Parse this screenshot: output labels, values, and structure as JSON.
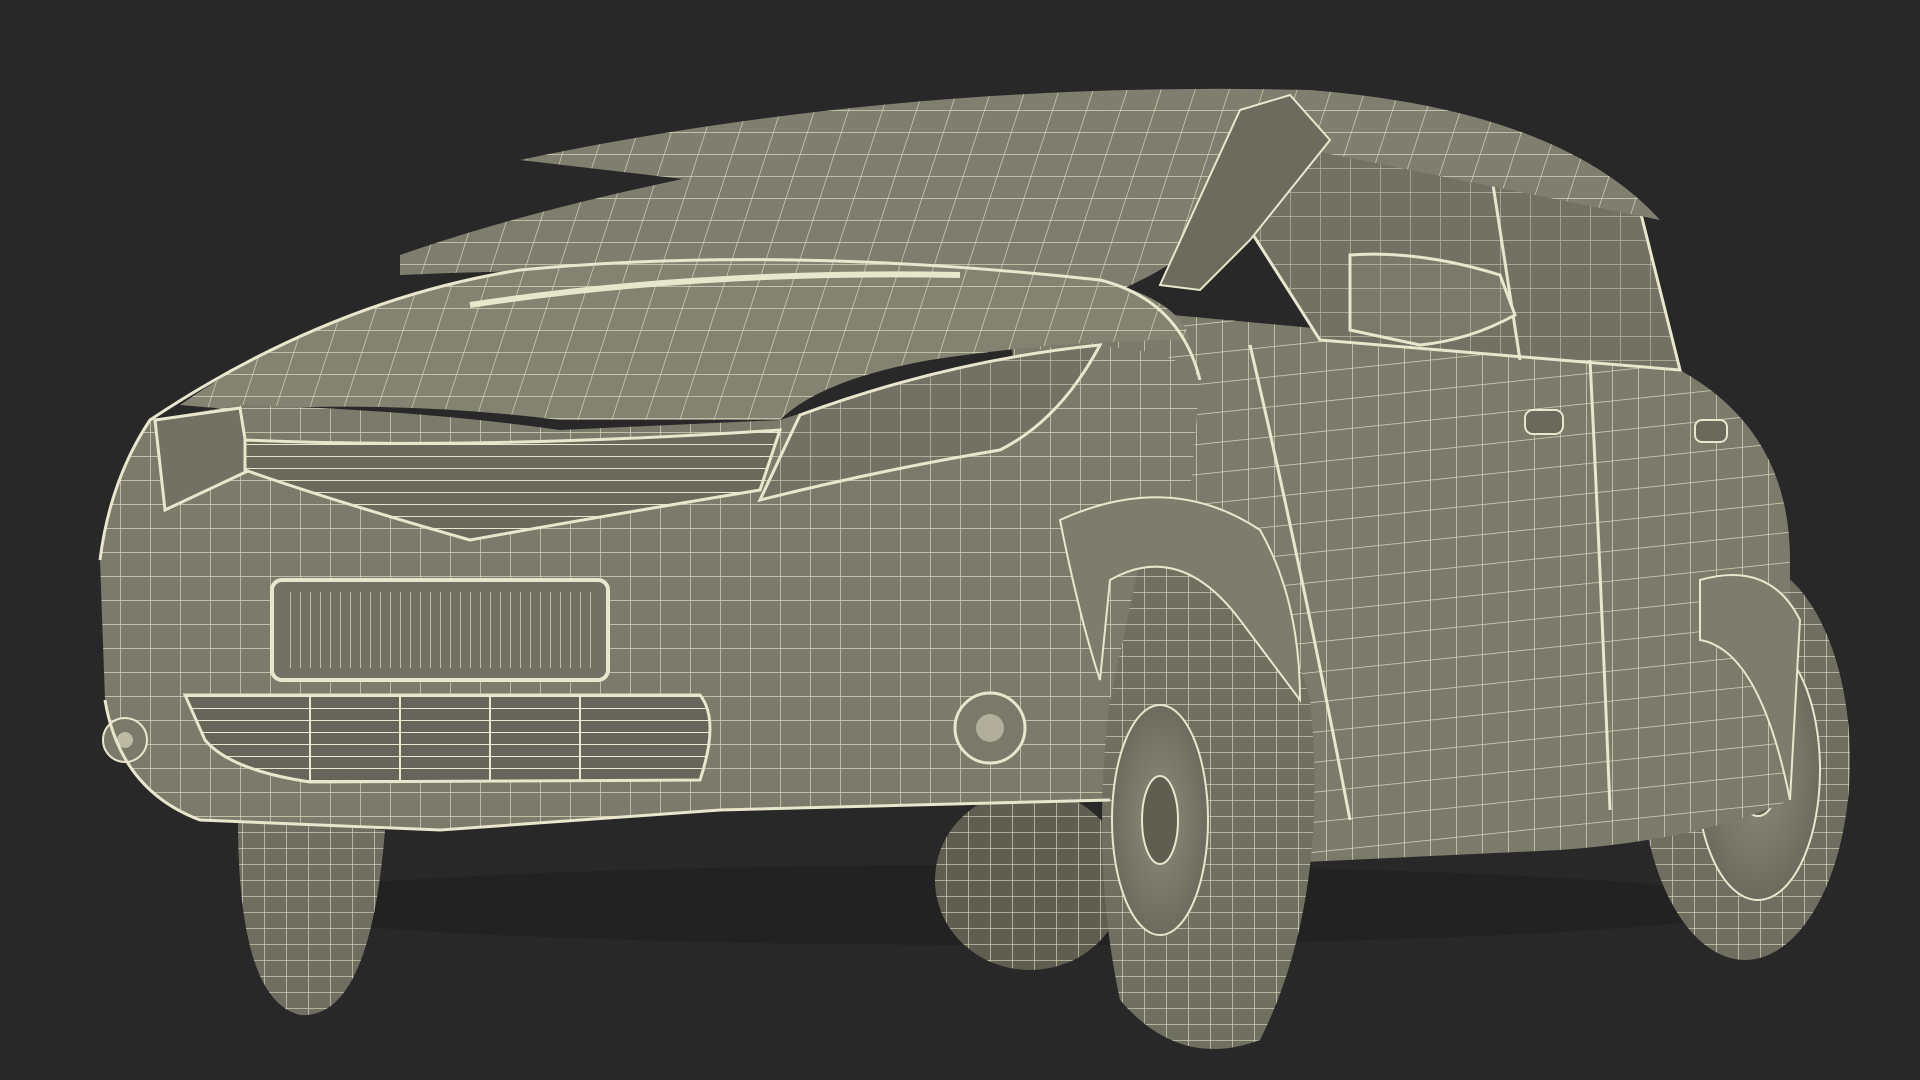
{
  "scene": {
    "subject": "hatchback-car-wireframe-render",
    "colors": {
      "background": "#282828",
      "surface": "#7b7a6b",
      "surface_light": "#8a8977",
      "surface_dark": "#5f5e51",
      "wire": "#e8e6cc",
      "shadow": "#46463d"
    }
  }
}
